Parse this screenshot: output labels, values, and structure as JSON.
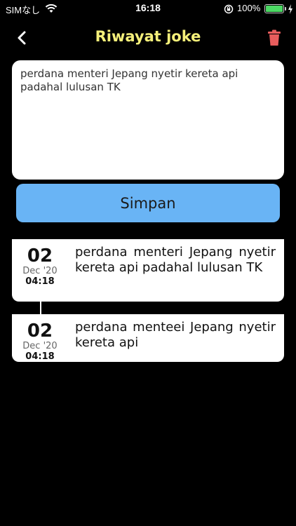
{
  "status_bar": {
    "carrier": "SIMなし",
    "time": "16:18",
    "battery_percent": "100%",
    "battery_level": 1.0
  },
  "nav": {
    "title": "Riwayat joke",
    "back_icon": "chevron-left-icon",
    "delete_icon": "trash-icon",
    "title_color": "#f5f07a",
    "delete_color": "#e85d5d"
  },
  "editor": {
    "value": "perdana menteri Jepang nyetir kereta api padahal lulusan TK"
  },
  "save_button": {
    "label": "Simpan",
    "color": "#69b4f5"
  },
  "history": [
    {
      "day": "02",
      "month": "Dec '20",
      "time": "04:18",
      "text": "perdana menteri Jepang nyetir kereta api padahal lulusan TK"
    },
    {
      "day": "02",
      "month": "Dec '20",
      "time": "04:18",
      "text": "perdana menteei Jepang nyetir kereta api"
    }
  ]
}
